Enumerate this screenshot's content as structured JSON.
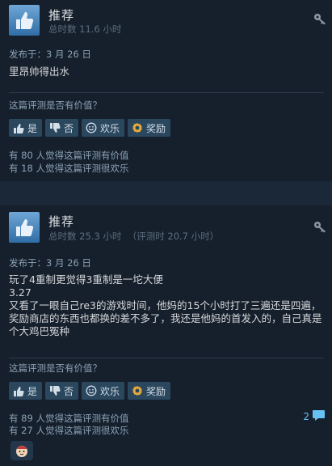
{
  "reviews": [
    {
      "title": "推荐",
      "hours": "总时数 11.6 小时",
      "posted": "发布于：3 月 26 日",
      "content": [
        "里昂帅得出水"
      ],
      "helpful_question": "这篇评测是否有价值？",
      "buttons": {
        "yes": "是",
        "no": "否",
        "funny": "欢乐",
        "award": "奖励"
      },
      "stats": [
        "有 80 人觉得这篇评测有价值",
        "有 18 人觉得这篇评测很欢乐"
      ]
    },
    {
      "title": "推荐",
      "hours": "总时数 25.3 小时  （评测时 20.7 小时）",
      "posted": "发布于：3 月 26 日",
      "content": [
        "玩了4重制更觉得3重制是一坨大便",
        "3.27",
        "又看了一眼自己re3的游戏时间，他妈的15个小时打了三遍还是四遍，奖励商店的东西也都换的差不多了，我还是他妈的首发入的，自己真是个大鸡巴冤种"
      ],
      "helpful_question": "这篇评测是否有价值？",
      "buttons": {
        "yes": "是",
        "no": "否",
        "funny": "欢乐",
        "award": "奖励"
      },
      "stats": [
        "有 89 人觉得这篇评测有价值",
        "有 27 人觉得这篇评测很欢乐"
      ],
      "comment_count": "2"
    }
  ],
  "colors": {
    "bg": "#1b2838",
    "card": "#16202d",
    "button": "#2a475e",
    "link": "#66c0f4",
    "award": "#e4a93b"
  },
  "icons": [
    "thumbs-up-icon",
    "key-icon",
    "thumb-up-small-icon",
    "thumb-down-icon",
    "smiley-icon",
    "award-icon",
    "comment-icon",
    "award-badge-icon"
  ]
}
